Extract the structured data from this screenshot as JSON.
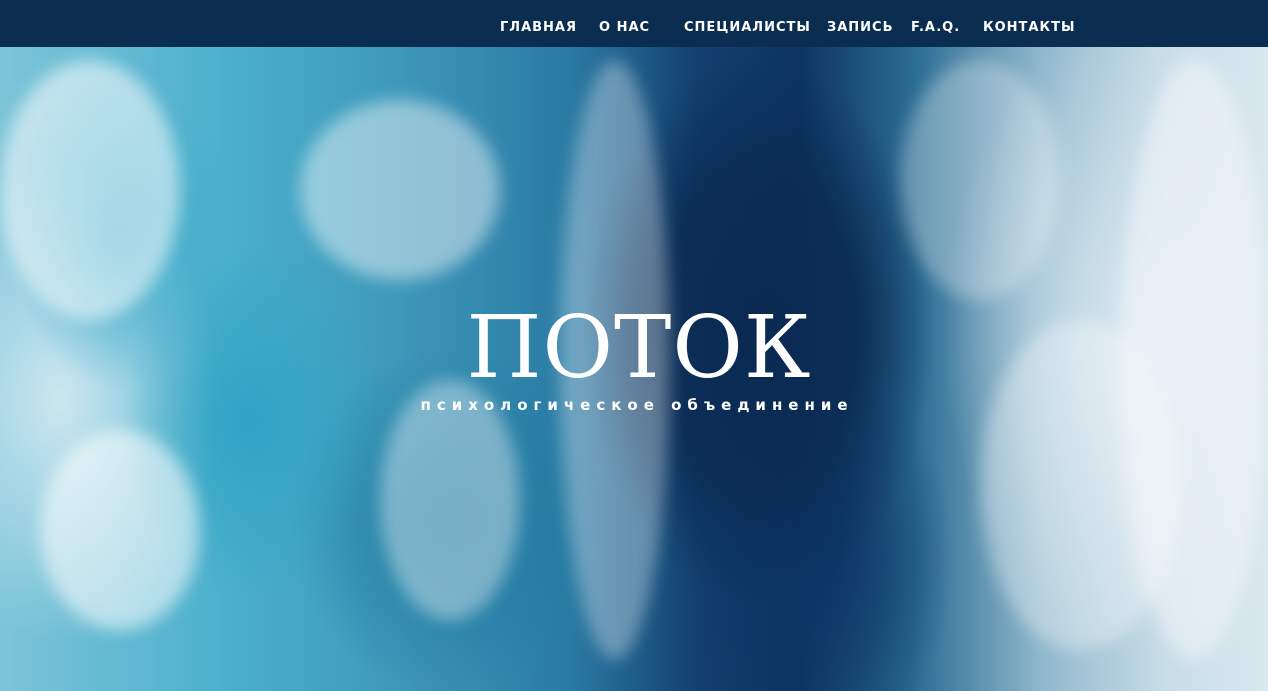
{
  "nav": {
    "items": [
      {
        "label": "ГЛАВНАЯ"
      },
      {
        "label": "О НАС"
      },
      {
        "label": "СПЕЦИАЛИСТЫ"
      },
      {
        "label": "ЗАПИСЬ"
      },
      {
        "label": "F.A.Q."
      },
      {
        "label": "КОНТАКТЫ"
      }
    ]
  },
  "hero": {
    "title": "ПОТОК",
    "subtitle": "психологическое объединение"
  },
  "colors": {
    "navbar": "#0b2e50",
    "text": "#ffffff"
  }
}
